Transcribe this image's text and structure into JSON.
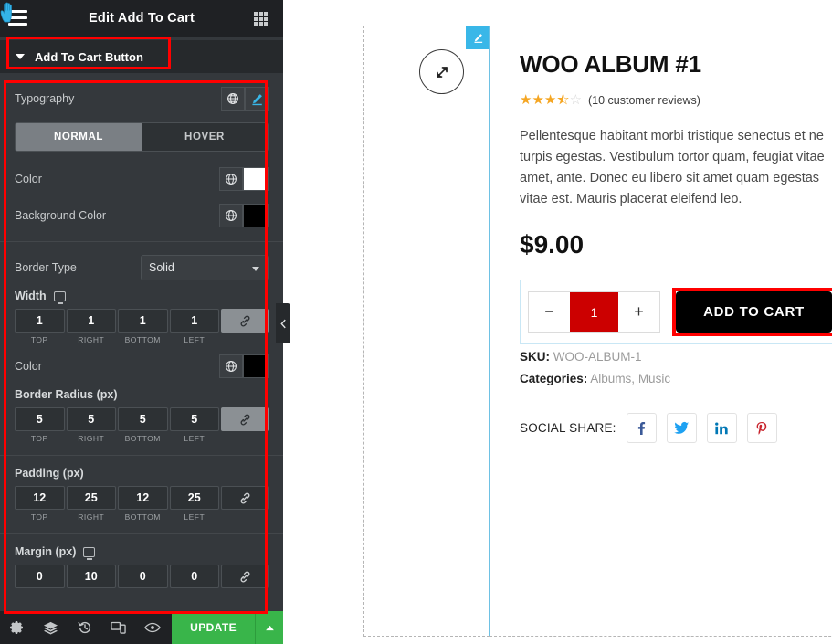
{
  "panel": {
    "title": "Edit Add To Cart",
    "menu_icon": "hamburger-icon",
    "widgets_icon": "grid-icon",
    "section": {
      "label": "Add To Cart Button",
      "caret": "chevron-down-icon"
    },
    "typography": {
      "label": "Typography",
      "global_icon": "globe-icon",
      "edit_icon": "pencil-icon"
    },
    "state_tabs": {
      "normal": "NORMAL",
      "hover": "HOVER",
      "active": "NORMAL"
    },
    "color": {
      "label": "Color",
      "global_icon": "globe-icon",
      "value": "#ffffff"
    },
    "background_color": {
      "label": "Background Color",
      "global_icon": "globe-icon",
      "value": "#000000"
    },
    "border_type": {
      "label": "Border Type",
      "value": "Solid",
      "caret": "chevron-down-icon"
    },
    "border_width": {
      "label": "Width",
      "device_icon": "desktop-icon",
      "values": [
        "1",
        "1",
        "1",
        "1"
      ],
      "sides": [
        "TOP",
        "RIGHT",
        "BOTTOM",
        "LEFT"
      ],
      "link_icon": "link-icon",
      "linked": true
    },
    "border_color": {
      "label": "Color",
      "global_icon": "globe-icon",
      "value": "#000000"
    },
    "border_radius": {
      "label": "Border Radius (px)",
      "values": [
        "5",
        "5",
        "5",
        "5"
      ],
      "sides": [
        "TOP",
        "RIGHT",
        "BOTTOM",
        "LEFT"
      ],
      "link_icon": "link-icon",
      "linked": true
    },
    "padding": {
      "label": "Padding (px)",
      "values": [
        "12",
        "25",
        "12",
        "25"
      ],
      "sides": [
        "TOP",
        "RIGHT",
        "BOTTOM",
        "LEFT"
      ],
      "link_icon": "link-icon",
      "linked": false
    },
    "margin": {
      "label": "Margin (px)",
      "device_icon": "desktop-icon",
      "values": [
        "0",
        "10",
        "0",
        "0"
      ],
      "link_icon": "link-icon",
      "linked": false
    },
    "footer": {
      "icons": [
        "gear-icon",
        "layers-icon",
        "history-icon",
        "responsive-icon",
        "preview-icon"
      ],
      "update_label": "UPDATE",
      "update_caret": "chevron-up-icon"
    },
    "collapse_handle": "chevron-left-icon"
  },
  "preview": {
    "edit_tab_icon": "pencil-icon",
    "resize_handle_icon": "resize-arrows-icon",
    "product": {
      "title": "WOO ALBUM #1",
      "rating_stars": "★★★⯪☆",
      "reviews": "(10 customer reviews)",
      "description_lines": [
        "Pellentesque habitant morbi tristique senectus et ne",
        "turpis egestas. Vestibulum tortor quam, feugiat vitae",
        "amet, ante. Donec eu libero sit amet quam egestas",
        "vitae est. Mauris placerat eleifend leo."
      ],
      "price": "$9.00",
      "qty": {
        "minus": "−",
        "value": "1",
        "plus": "+"
      },
      "add_to_cart": "ADD TO CART",
      "sku_label": "SKU:",
      "sku_value": "WOO-ALBUM-1",
      "categories_label": "Categories:",
      "categories_value": "Albums, Music",
      "social_label": "SOCIAL SHARE:",
      "social": [
        {
          "name": "facebook-icon",
          "glyph": "f",
          "color": "#3b5998"
        },
        {
          "name": "twitter-icon",
          "glyph": "t",
          "color": "#1da1f2"
        },
        {
          "name": "linkedin-icon",
          "glyph": "in",
          "color": "#0077b5"
        },
        {
          "name": "pinterest-icon",
          "glyph": "p",
          "color": "#c8232c"
        }
      ]
    }
  }
}
